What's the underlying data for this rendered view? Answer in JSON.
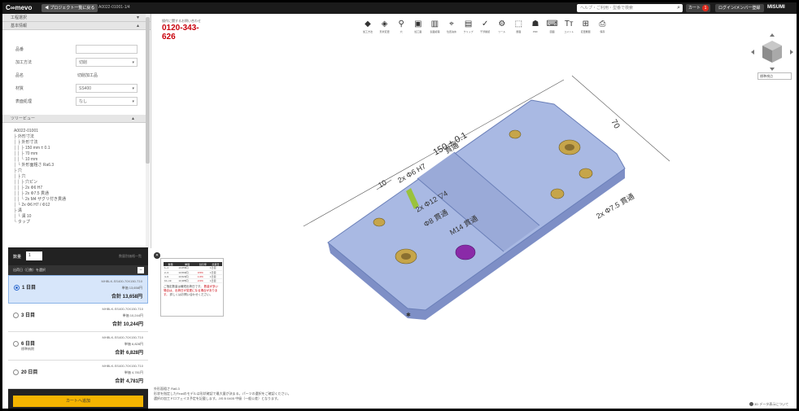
{
  "topbar": {
    "logo": "C∞mevo",
    "back_label": "◀ プロジェクト一覧に戻る",
    "project_id": "A0022-01001-1/4",
    "search_placeholder": "ヘルプ・ご利用・型番で検索",
    "cart_label": "カート",
    "cart_count": "1",
    "mypage_label": "ログイン/メンバー登録",
    "brand": "MISUMI"
  },
  "sidebar": {
    "section1": "工程選択",
    "section2": "基本情報",
    "form": [
      {
        "label": "品番",
        "value": "",
        "type": "input"
      },
      {
        "label": "加工方法",
        "value": "切削",
        "type": "select"
      },
      {
        "label": "品名",
        "value": "切削加工品",
        "type": "text"
      },
      {
        "label": "材質",
        "value": "SS400",
        "type": "select"
      },
      {
        "label": "表面処理",
        "value": "なし",
        "type": "select"
      }
    ],
    "section3": "ツリービュー",
    "tree": [
      "A0022-01001",
      "├ 外形寸法",
      "│ ├ 外形寸法",
      "│ │ ├ 150 mm ± 0.1",
      "│ │ ├ 70 mm",
      "│ │ └ 10 mm",
      "│ └ 外形面粗さ Ra6.3",
      "├ 穴",
      "│ ├ 穴",
      "│ │ ├ 穴ピン",
      "│ │ ├ 2x Φ6 H7",
      "│ │ ├ 2x Φ7.5 貫通",
      "│ │ └ 2x M4 ザグリ付き貫通",
      "│ └ 2x Φ6 H7 / Φ12",
      "├ 溝",
      "│ └ 溝 10",
      "└ タップ"
    ]
  },
  "order": {
    "qty_label": "数量",
    "qty_value": "1",
    "qty_right": "数量別価格一覧",
    "ship_head": "出荷日（日数）を選択",
    "items": [
      {
        "days": "1 日目",
        "sub": "",
        "part": "MHBLK-SS400-70X150-T10",
        "unit": "単価 13,658円",
        "total": "合計 13,658円",
        "selected": true
      },
      {
        "days": "3 日目",
        "sub": "",
        "part": "MHBLK-SS400-70X150-T10",
        "unit": "単価 10,244円",
        "total": "合計 10,244円",
        "selected": false
      },
      {
        "days": "6 日目",
        "sub": "標準納期",
        "part": "MHBLK-SS400-70X150-T10",
        "unit": "単価 6,828円",
        "total": "合計 6,828円",
        "selected": false
      },
      {
        "days": "20 日目",
        "sub": "",
        "part": "MHBLK-SS400-70X150-T10",
        "unit": "単価 4,781円",
        "total": "合計 4,781円",
        "selected": false
      }
    ],
    "cart_button": "カートへ追加"
  },
  "phone": {
    "small": "操作に関するお問い合わせ",
    "number": "0120-343-626"
  },
  "toolbar": [
    {
      "icon": "◆",
      "label": "加工方法"
    },
    {
      "icon": "◈",
      "label": "形状変更"
    },
    {
      "icon": "⚲",
      "label": "穴"
    },
    {
      "icon": "▣",
      "label": "加工面"
    },
    {
      "icon": "▥",
      "label": "表面処理"
    },
    {
      "icon": "⌖",
      "label": "位置決め"
    },
    {
      "icon": "▤",
      "label": "クリップ"
    },
    {
      "icon": "✓",
      "label": "干渉確認"
    },
    {
      "icon": "⚙",
      "label": "ツール"
    },
    {
      "icon": "⬚",
      "label": "断面"
    },
    {
      "icon": "☗",
      "label": "PDF"
    },
    {
      "icon": "⌨",
      "label": "図面"
    },
    {
      "icon": "Tт",
      "label": "コメント"
    },
    {
      "icon": "⊞",
      "label": "変更履歴"
    },
    {
      "icon": "⎙",
      "label": "保存"
    }
  ],
  "view_select": "標準視点",
  "model": {
    "dim_length": "150 ± 0.1",
    "dim_width": "70",
    "dim_10": "10",
    "dim_hole1": "2x Φ6 H7",
    "dim_through1": "貫通",
    "dim_cb": "2x Φ12 ▽4",
    "dim_through2": "Φ8 貫通",
    "dim_m14": "M14 貫通",
    "dim_hole2": "2x Φ7.5 貫通"
  },
  "price_popup": {
    "headers": [
      "数量",
      "単価",
      "割引率",
      "出荷日"
    ],
    "rows": [
      [
        "1~1",
        "13,658円",
        "",
        "1日目"
      ],
      [
        "2~3",
        "13,590円",
        "0.5%",
        "1日目"
      ],
      [
        "4~9",
        "13,520円",
        "1.0%",
        "1日目"
      ],
      [
        "10~19",
        "13,385円",
        "2.0%",
        "1日目"
      ]
    ],
    "note1": "ご指定数量は最短出荷日です。",
    "note2": "数量が多い場合は、出荷日が変更になる場合があります。",
    "note3": "詳しくはお問い合わせください。"
  },
  "bottom_note": {
    "line1": "外形面粗さ Ra6.3",
    "line2": "形状を指定したFinalのモデルは形状確認で最大量が決まる。パーツの選択をご確認ください。",
    "line3": "選択の加工ドロフェイス予定を記載します。JIS B 0405 中級（一般公差）となります。"
  },
  "bottom_right": "3D データ表示について",
  "colors": {
    "plate": "#a9b9e3",
    "hole_gold": "#c6a54a",
    "hole_purple": "#8a2aa8",
    "accent_yellow": "#f4b400",
    "phone_red": "#c9000b"
  }
}
